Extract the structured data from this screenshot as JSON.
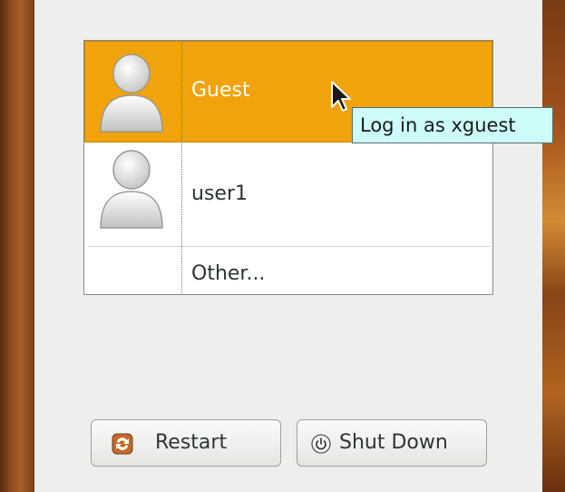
{
  "users": {
    "guest": {
      "label": "Guest",
      "icon": "user-avatar-icon",
      "selected": true
    },
    "user1": {
      "label": "user1",
      "icon": "user-avatar-icon"
    },
    "other": {
      "label": "Other..."
    }
  },
  "tooltip": {
    "text": "Log in as xguest"
  },
  "buttons": {
    "restart": {
      "label": "Restart",
      "icon": "restart-icon"
    },
    "shutdown": {
      "label": "Shut Down",
      "icon": "power-icon"
    }
  },
  "colors": {
    "selection": "#f0a30a",
    "tooltip_bg": "#ccfbf9",
    "panel_bg": "#eeeeec"
  }
}
